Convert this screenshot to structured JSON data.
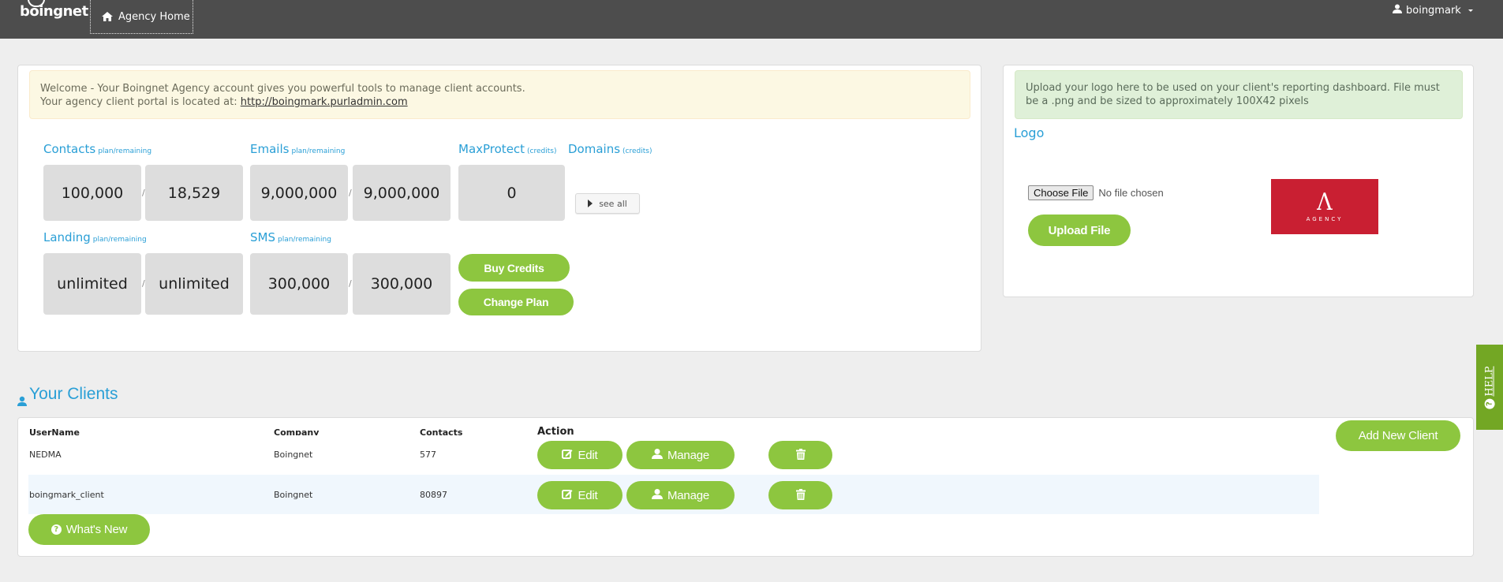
{
  "header": {
    "brand": "boingnet",
    "home_tab": "Agency Home",
    "user": "boingmark"
  },
  "welcome": {
    "line1": "Welcome - Your Boingnet Agency account gives you powerful tools to manage client accounts.",
    "line2_prefix": "Your agency client portal is located at: ",
    "portal_link": "http://boingmark.purladmin.com"
  },
  "stats": {
    "sublabel_plan": "plan/remaining",
    "sublabel_credits": "(credits)",
    "contacts": {
      "label": "Contacts",
      "plan": "100,000",
      "remaining": "18,529"
    },
    "emails": {
      "label": "Emails",
      "plan": "9,000,000",
      "remaining": "9,000,000"
    },
    "maxprotect": {
      "label": "MaxProtect",
      "value": "0"
    },
    "domains": {
      "label": "Domains",
      "see_all": "see all"
    },
    "landing": {
      "label": "Landing",
      "plan": "unlimited",
      "remaining": "unlimited"
    },
    "sms": {
      "label": "SMS",
      "plan": "300,000",
      "remaining": "300,000"
    },
    "separator": "/",
    "buy_credits": "Buy Credits",
    "change_plan": "Change Plan"
  },
  "logo_panel": {
    "notice": "Upload your logo here to be used on your client's reporting dashboard. File must be a .png and be sized to approximately 100X42 pixels",
    "title": "Logo",
    "choose_file": "Choose File",
    "no_file": "No file chosen",
    "upload": "Upload File",
    "current_logo": {
      "mark": "Λ",
      "word": "AGENCY",
      "bg_color": "#c91f32"
    }
  },
  "clients": {
    "title": "Your Clients",
    "columns": {
      "username": "UserName",
      "company": "Company",
      "contacts": "Contacts",
      "action": "Action"
    },
    "rows": [
      {
        "username": "NEDMA",
        "company": "Boingnet",
        "contacts": "577"
      },
      {
        "username": "boingmark_client",
        "company": "Boingnet",
        "contacts": "80897"
      }
    ],
    "edit": "Edit",
    "manage": "Manage",
    "add_new": "Add New Client",
    "whats_new": "What's New"
  },
  "help": {
    "label": "HELP"
  },
  "colors": {
    "accent_blue": "#2a9fd6",
    "button_green": "#8dc63f",
    "help_green": "#73a724",
    "header_bg": "#4d4d4d"
  }
}
